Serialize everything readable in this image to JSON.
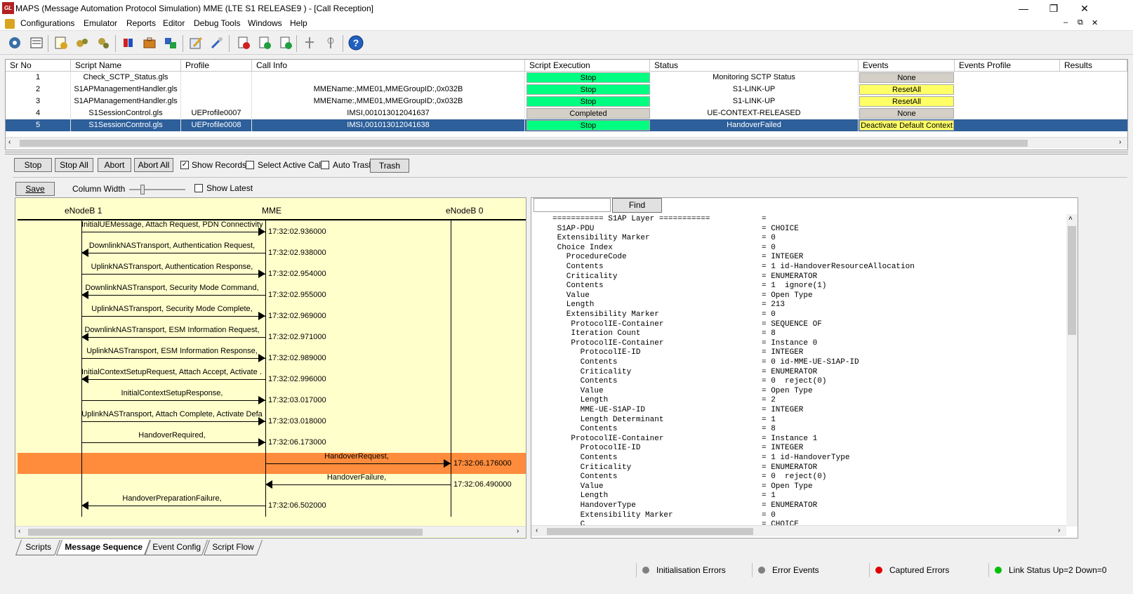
{
  "window": {
    "title": "MAPS (Message Automation Protocol Simulation) MME (LTE S1 RELEASE9 ) - [Call Reception]",
    "app_icon_text": "GL",
    "controls": [
      "—",
      "❐",
      "✕"
    ],
    "mdi_controls": [
      "–",
      "⧉",
      "✕"
    ]
  },
  "menu": [
    "Configurations",
    "Emulator",
    "Reports",
    "Editor",
    "Debug Tools",
    "Windows",
    "Help"
  ],
  "toolbar": {
    "icons": [
      "settings-icon",
      "script-editor-icon",
      "profile-edit-icon",
      "load-icon",
      "gear-group-icon",
      "database-icon",
      "briefcase-icon",
      "network-config-icon",
      "edit-pencil-icon",
      "tools-icon",
      "incoming-call-icon",
      "call-control-icon",
      "call-placement-icon",
      "signal-icon",
      "antenna-icon",
      "help-icon"
    ],
    "help_glyph": "?"
  },
  "grid": {
    "columns": [
      "Sr No",
      "Script Name",
      "Profile",
      "Call Info",
      "Script Execution",
      "Status",
      "Events",
      "Events Profile",
      "Results"
    ],
    "rows": [
      {
        "sr": "1",
        "script": "Check_SCTP_Status.gls",
        "profile": "",
        "callinfo": "",
        "exec": "Stop",
        "status": "Monitoring SCTP Status",
        "events": "None"
      },
      {
        "sr": "2",
        "script": "S1APManagementHandler.gls",
        "profile": "",
        "callinfo": "MMEName:,MME01,MMEGroupID:,0x032B",
        "exec": "Stop",
        "status": "S1-LINK-UP",
        "events": "ResetAll"
      },
      {
        "sr": "3",
        "script": "S1APManagementHandler.gls",
        "profile": "",
        "callinfo": "MMEName:,MME01,MMEGroupID:,0x032B",
        "exec": "Stop",
        "status": "S1-LINK-UP",
        "events": "ResetAll"
      },
      {
        "sr": "4",
        "script": "S1SessionControl.gls",
        "profile": "UEProfile0007",
        "callinfo": "IMSI,001013012041637",
        "exec": "Completed",
        "status": "UE-CONTEXT-RELEASED",
        "events": "None"
      },
      {
        "sr": "5",
        "script": "S1SessionControl.gls",
        "profile": "UEProfile0008",
        "callinfo": "IMSI,001013012041638",
        "exec": "Stop",
        "status": "HandoverFailed",
        "events": "Deactivate Default Context"
      }
    ]
  },
  "controls": {
    "stop": "Stop",
    "stop_all": "Stop All",
    "abort": "Abort",
    "abort_all": "Abort All",
    "show_records": "Show Records",
    "show_records_checked": true,
    "select_active_call": "Select Active Call",
    "auto_trash": "Auto Trash",
    "trash": "Trash"
  },
  "seq_controls": {
    "save": "Save",
    "column_width": "Column Width",
    "show_latest": "Show Latest"
  },
  "sequence": {
    "lanes": [
      "eNodeB 1",
      "MME",
      "eNodeB 0"
    ],
    "messages": [
      {
        "label": "InitialUEMessage,  Attach Request,  PDN Connectivity",
        "time": "17:32:02.936000",
        "dir": "to-mme-from-enb1"
      },
      {
        "label": "DownlinkNASTransport,  Authentication Request,",
        "time": "17:32:02.938000",
        "dir": "to-enb1"
      },
      {
        "label": "UplinkNASTransport,  Authentication Response,",
        "time": "17:32:02.954000",
        "dir": "to-mme-from-enb1"
      },
      {
        "label": "DownlinkNASTransport,  Security Mode Command,",
        "time": "17:32:02.955000",
        "dir": "to-enb1"
      },
      {
        "label": "UplinkNASTransport,  Security Mode Complete,",
        "time": "17:32:02.969000",
        "dir": "to-mme-from-enb1"
      },
      {
        "label": "DownlinkNASTransport,  ESM Information Request,",
        "time": "17:32:02.971000",
        "dir": "to-enb1"
      },
      {
        "label": "UplinkNASTransport,  ESM Information Response,",
        "time": "17:32:02.989000",
        "dir": "to-mme-from-enb1"
      },
      {
        "label": "InitialContextSetupRequest,  Attach Accept,  Activate ...",
        "time": "17:32:02.996000",
        "dir": "to-enb1"
      },
      {
        "label": "InitialContextSetupResponse,",
        "time": "17:32:03.017000",
        "dir": "to-mme-from-enb1"
      },
      {
        "label": "UplinkNASTransport,  Attach Complete,  Activate Defa",
        "time": "17:32:03.018000",
        "dir": "to-mme-from-enb1"
      },
      {
        "label": "HandoverRequired,",
        "time": "17:32:06.173000",
        "dir": "to-mme-from-enb1"
      },
      {
        "label": "HandoverRequest,",
        "time": "17:32:06.176000",
        "dir": "to-enb0",
        "highlight": true
      },
      {
        "label": "HandoverFailure,",
        "time": "17:32:06.490000",
        "dir": "to-mme-from-enb0"
      },
      {
        "label": "HandoverPreparationFailure,",
        "time": "17:32:06.502000",
        "dir": "to-enb1"
      }
    ]
  },
  "decode": {
    "find": "Find",
    "search_value": "",
    "lines": [
      [
        "=========== S1AP Layer ===========",
        "="
      ],
      [
        " S1AP-PDU",
        "= CHOICE"
      ],
      [
        " Extensibility Marker",
        "= 0"
      ],
      [
        " Choice Index",
        "= 0"
      ],
      [
        "   ProcedureCode",
        "= INTEGER"
      ],
      [
        "   Contents",
        "= 1 id-HandoverResourceAllocation"
      ],
      [
        "   Criticality",
        "= ENUMERATOR"
      ],
      [
        "   Contents",
        "= 1  ignore(1)"
      ],
      [
        "   Value",
        "= Open Type"
      ],
      [
        "   Length",
        "= 213"
      ],
      [
        "   Extensibility Marker",
        "= 0"
      ],
      [
        "    ProtocolIE-Container",
        "= SEQUENCE OF"
      ],
      [
        "    Iteration Count",
        "= 8"
      ],
      [
        "    ProtocolIE-Container",
        "= Instance 0"
      ],
      [
        "      ProtocolIE-ID",
        "= INTEGER"
      ],
      [
        "      Contents",
        "= 0 id-MME-UE-S1AP-ID"
      ],
      [
        "      Criticality",
        "= ENUMERATOR"
      ],
      [
        "      Contents",
        "= 0  reject(0)"
      ],
      [
        "      Value",
        "= Open Type"
      ],
      [
        "      Length",
        "= 2"
      ],
      [
        "      MME-UE-S1AP-ID",
        "= INTEGER"
      ],
      [
        "      Length Determinant",
        "= 1"
      ],
      [
        "      Contents",
        "= 8"
      ],
      [
        "    ProtocolIE-Container",
        "= Instance 1"
      ],
      [
        "      ProtocolIE-ID",
        "= INTEGER"
      ],
      [
        "      Contents",
        "= 1 id-HandoverType"
      ],
      [
        "      Criticality",
        "= ENUMERATOR"
      ],
      [
        "      Contents",
        "= 0  reject(0)"
      ],
      [
        "      Value",
        "= Open Type"
      ],
      [
        "      Length",
        "= 1"
      ],
      [
        "      HandoverType",
        "= ENUMERATOR"
      ],
      [
        "      Extensibility Marker",
        "= 0"
      ],
      [
        "      C",
        "= CHOICE"
      ]
    ]
  },
  "tabs": [
    "Scripts",
    "Message Sequence",
    "Event Config",
    "Script Flow"
  ],
  "active_tab": "Message Sequence",
  "status_bar": [
    {
      "label": "Initialisation Errors",
      "color": "#808080"
    },
    {
      "label": "Error Events",
      "color": "#808080"
    },
    {
      "label": "Captured Errors",
      "color": "#e00000"
    },
    {
      "label": "Link Status Up=2 Down=0",
      "color": "#00c000"
    }
  ],
  "colors": {
    "selected_row": "#2d5f9a",
    "stop_green": "#00ff80",
    "seq_bg": "#ffffcc",
    "highlight": "#ff8c3c",
    "event_yellow": "#ffff66"
  }
}
